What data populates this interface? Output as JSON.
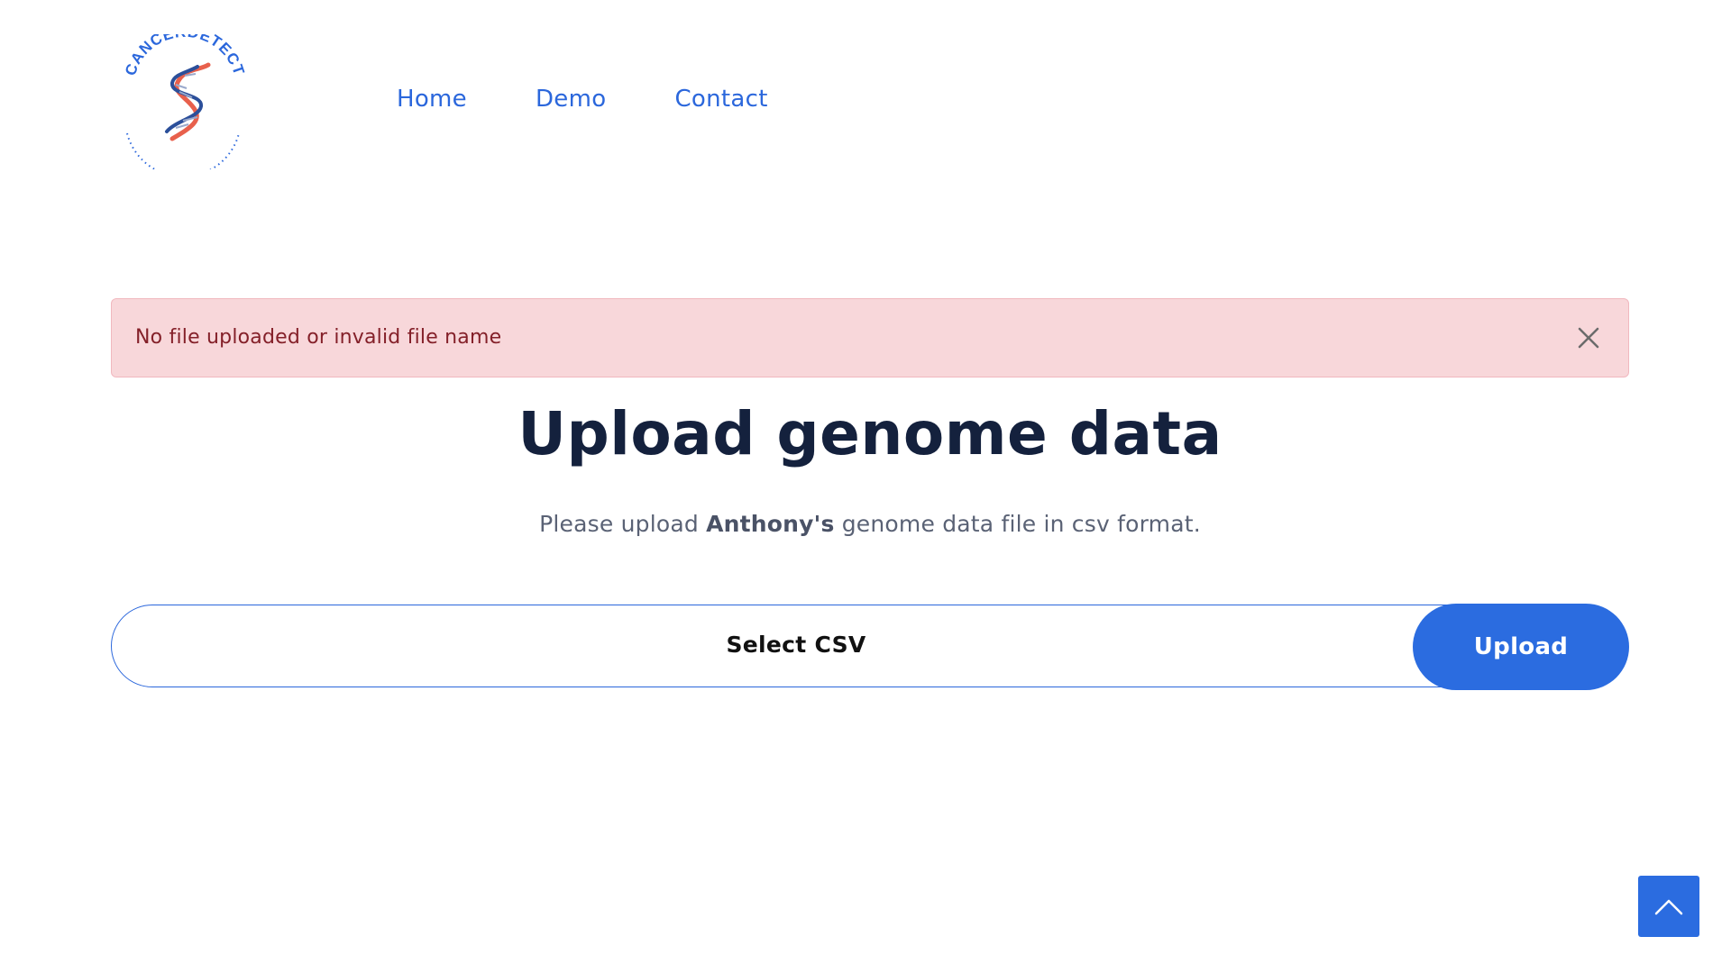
{
  "brand": {
    "logo_text": "CANCERDETECT"
  },
  "nav": {
    "items": [
      {
        "label": "Home"
      },
      {
        "label": "Demo"
      },
      {
        "label": "Contact"
      }
    ]
  },
  "alert": {
    "message": "No file uploaded or invalid file name",
    "close_icon": "close-icon",
    "colors": {
      "background": "#f8d7da",
      "text": "#842029"
    }
  },
  "main": {
    "title": "Upload genome data",
    "subtitle_prefix": "Please upload ",
    "subtitle_name": "Anthony's",
    "subtitle_suffix": " genome data file in csv format."
  },
  "upload": {
    "select_label": "Select CSV",
    "button_label": "Upload",
    "accent_color": "#2b6ce0"
  },
  "scroll_top": {
    "icon": "chevron-up-icon"
  }
}
